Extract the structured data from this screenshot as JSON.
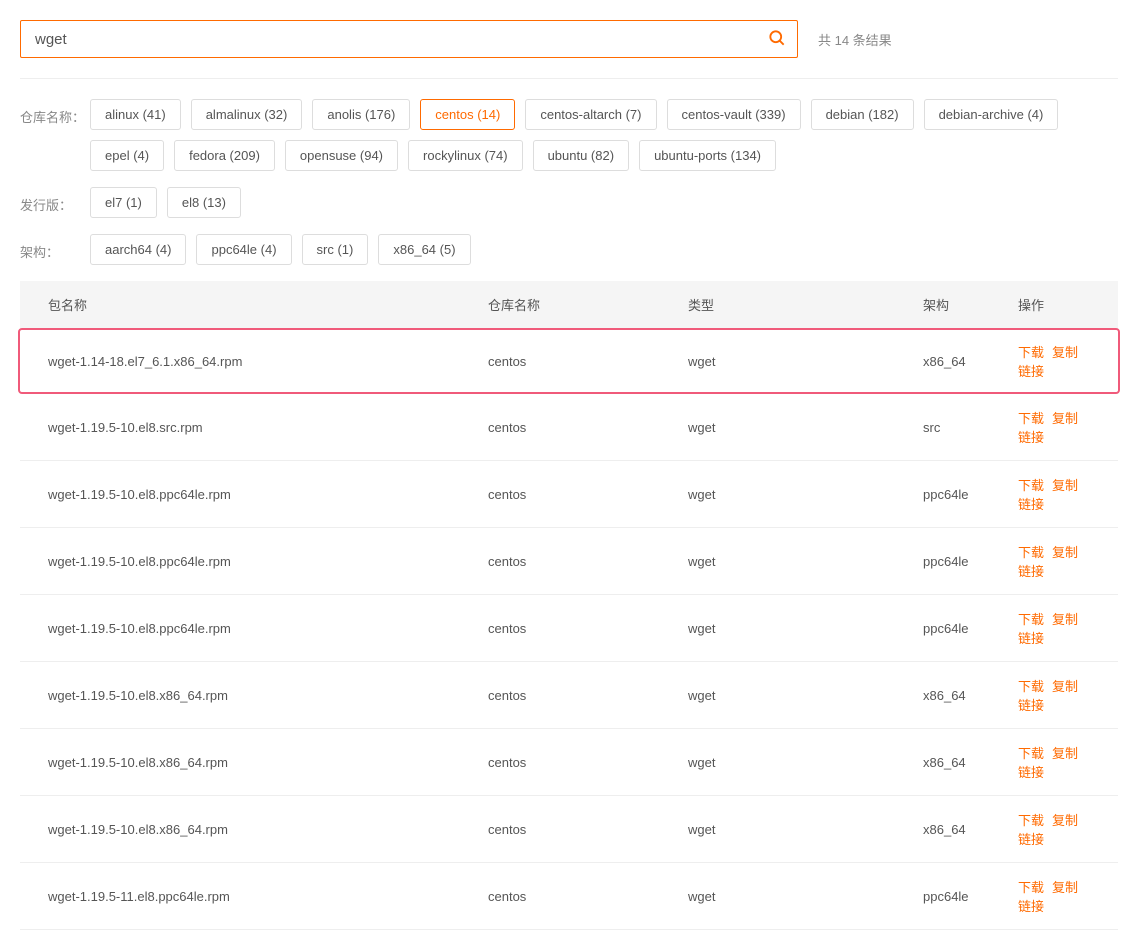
{
  "search": {
    "value": "wget",
    "results_text": "共 14 条结果"
  },
  "filters": {
    "repo": {
      "label": "仓库名称：",
      "tags": [
        {
          "label": "alinux (41)",
          "active": false
        },
        {
          "label": "almalinux (32)",
          "active": false
        },
        {
          "label": "anolis (176)",
          "active": false
        },
        {
          "label": "centos (14)",
          "active": true
        },
        {
          "label": "centos-altarch (7)",
          "active": false
        },
        {
          "label": "centos-vault (339)",
          "active": false
        },
        {
          "label": "debian (182)",
          "active": false
        },
        {
          "label": "debian-archive (4)",
          "active": false
        },
        {
          "label": "epel (4)",
          "active": false
        },
        {
          "label": "fedora (209)",
          "active": false
        },
        {
          "label": "opensuse (94)",
          "active": false
        },
        {
          "label": "rockylinux (74)",
          "active": false
        },
        {
          "label": "ubuntu (82)",
          "active": false
        },
        {
          "label": "ubuntu-ports (134)",
          "active": false
        }
      ]
    },
    "release": {
      "label": "发行版：",
      "tags": [
        {
          "label": "el7 (1)",
          "active": false
        },
        {
          "label": "el8 (13)",
          "active": false
        }
      ]
    },
    "arch": {
      "label": "架构：",
      "tags": [
        {
          "label": "aarch64 (4)",
          "active": false
        },
        {
          "label": "ppc64le (4)",
          "active": false
        },
        {
          "label": "src (1)",
          "active": false
        },
        {
          "label": "x86_64 (5)",
          "active": false
        }
      ]
    }
  },
  "table": {
    "headers": {
      "name": "包名称",
      "repo": "仓库名称",
      "type": "类型",
      "arch": "架构",
      "action": "操作"
    },
    "actions": {
      "download": "下载",
      "copy": "复制链接"
    },
    "rows": [
      {
        "name": "wget-1.14-18.el7_6.1.x86_64.rpm",
        "repo": "centos",
        "type": "wget",
        "arch": "x86_64",
        "hl": true
      },
      {
        "name": "wget-1.19.5-10.el8.src.rpm",
        "repo": "centos",
        "type": "wget",
        "arch": "src",
        "hl": false
      },
      {
        "name": "wget-1.19.5-10.el8.ppc64le.rpm",
        "repo": "centos",
        "type": "wget",
        "arch": "ppc64le",
        "hl": false
      },
      {
        "name": "wget-1.19.5-10.el8.ppc64le.rpm",
        "repo": "centos",
        "type": "wget",
        "arch": "ppc64le",
        "hl": false
      },
      {
        "name": "wget-1.19.5-10.el8.ppc64le.rpm",
        "repo": "centos",
        "type": "wget",
        "arch": "ppc64le",
        "hl": false
      },
      {
        "name": "wget-1.19.5-10.el8.x86_64.rpm",
        "repo": "centos",
        "type": "wget",
        "arch": "x86_64",
        "hl": false
      },
      {
        "name": "wget-1.19.5-10.el8.x86_64.rpm",
        "repo": "centos",
        "type": "wget",
        "arch": "x86_64",
        "hl": false
      },
      {
        "name": "wget-1.19.5-10.el8.x86_64.rpm",
        "repo": "centos",
        "type": "wget",
        "arch": "x86_64",
        "hl": false
      },
      {
        "name": "wget-1.19.5-11.el8.ppc64le.rpm",
        "repo": "centos",
        "type": "wget",
        "arch": "ppc64le",
        "hl": false
      }
    ]
  }
}
